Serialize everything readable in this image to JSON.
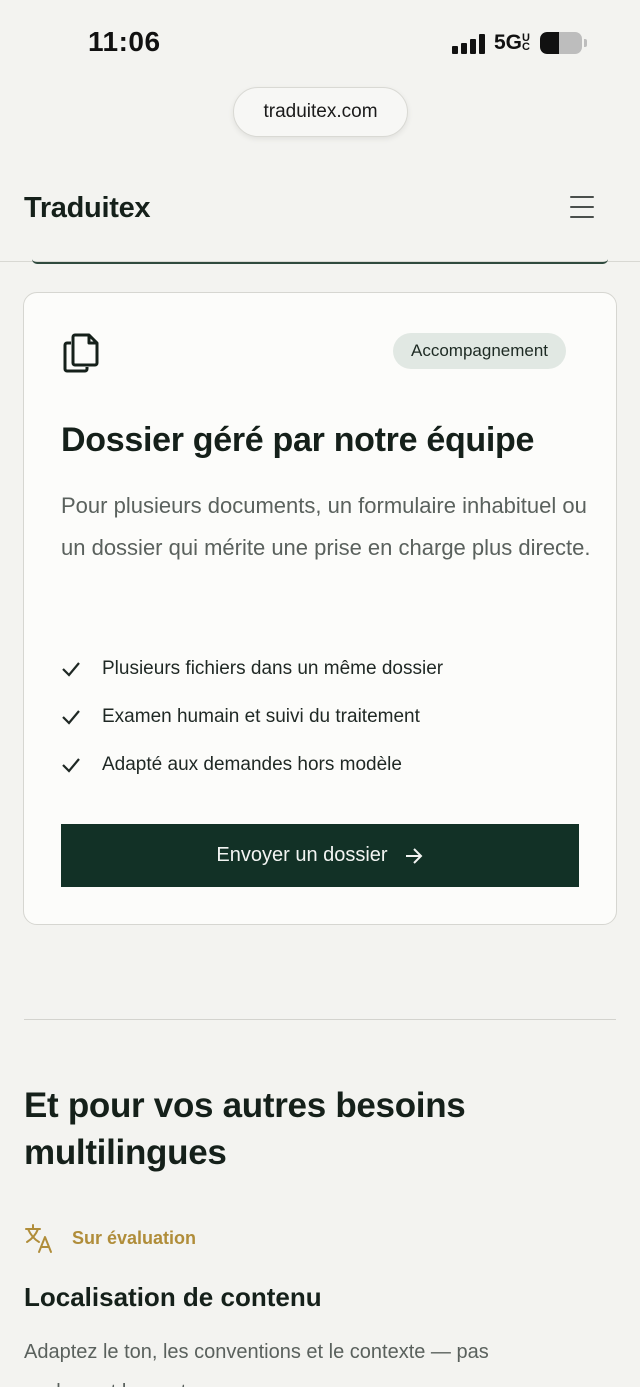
{
  "status_bar": {
    "time": "11:06",
    "network": "5G",
    "network_badge": "UC",
    "battery_level": 0.45,
    "signal_bars": 4
  },
  "browser": {
    "url": "traduitex.com"
  },
  "header": {
    "logo": "Traduitex",
    "menu_icon": "hamburger-menu-icon"
  },
  "card": {
    "icon": "copy-documents-icon",
    "badge": "Accompagnement",
    "title": "Dossier géré par notre équipe",
    "description": "Pour plusieurs documents, un formulaire inhabituel ou un dossier qui mérite une prise en charge plus directe.",
    "features": [
      "Plusieurs fichiers dans un même dossier",
      "Examen humain et suivi du traitement",
      "Adapté aux demandes hors modèle"
    ],
    "cta_label": "Envoyer un dossier",
    "accent": "#123126"
  },
  "section": {
    "title": "Et pour vos autres besoins multilingues",
    "sub_label": "Sur évaluation",
    "sub_icon": "translate-icon",
    "service_title": "Localisation de contenu",
    "service_desc": "Adaptez le ton, les conventions et le contexte — pas seulement les mots."
  },
  "colors": {
    "background": "#f3f3f0",
    "gold": "#b08d3a",
    "dark_green": "#123126"
  }
}
